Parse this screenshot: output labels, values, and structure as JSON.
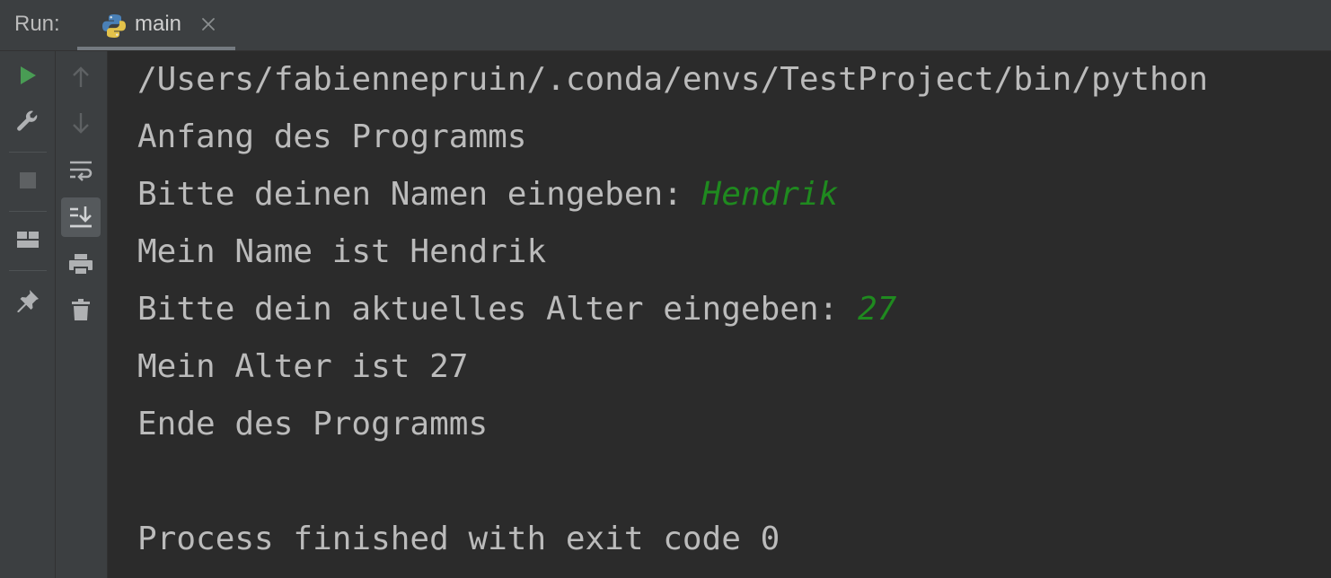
{
  "run_panel": {
    "label": "Run:",
    "tab": {
      "label": "main",
      "icon": "python-icon",
      "close_icon": "close-icon"
    }
  },
  "toolbar_outer": [
    {
      "name": "rerun-button",
      "icon": "play-icon",
      "color": "#499c54"
    },
    {
      "name": "edit-config-button",
      "icon": "wrench-icon"
    },
    {
      "name": "stop-button",
      "icon": "stop-icon",
      "disabled": true
    },
    {
      "name": "restore-layout-button",
      "icon": "layout-icon"
    },
    {
      "name": "pin-tab-button",
      "icon": "pin-icon"
    }
  ],
  "toolbar_inner": [
    {
      "name": "scroll-up-button",
      "icon": "arrow-up-icon",
      "disabled": true
    },
    {
      "name": "scroll-down-button",
      "icon": "arrow-down-icon",
      "disabled": true
    },
    {
      "name": "soft-wrap-button",
      "icon": "soft-wrap-icon"
    },
    {
      "name": "scroll-to-end-button",
      "icon": "scroll-to-end-icon",
      "active": true
    },
    {
      "name": "print-button",
      "icon": "printer-icon"
    },
    {
      "name": "clear-all-button",
      "icon": "trash-icon"
    }
  ],
  "console": {
    "lines": [
      {
        "text": "/Users/fabiennepruin/.conda/envs/TestProject/bin/python"
      },
      {
        "text": "Anfang des Programms"
      },
      {
        "text": "Bitte deinen Namen eingeben: ",
        "input": "Hendrik"
      },
      {
        "text": "Mein Name ist Hendrik"
      },
      {
        "text": "Bitte dein aktuelles Alter eingeben: ",
        "input": "27"
      },
      {
        "text": "Mein Alter ist 27"
      },
      {
        "text": "Ende des Programms"
      },
      {
        "text": ""
      },
      {
        "text": "Process finished with exit code 0"
      }
    ]
  },
  "colors": {
    "background": "#2b2b2b",
    "panel": "#3c3f41",
    "text": "#bbbbbb",
    "user_input": "#1f8a1f",
    "run_green": "#499c54"
  }
}
